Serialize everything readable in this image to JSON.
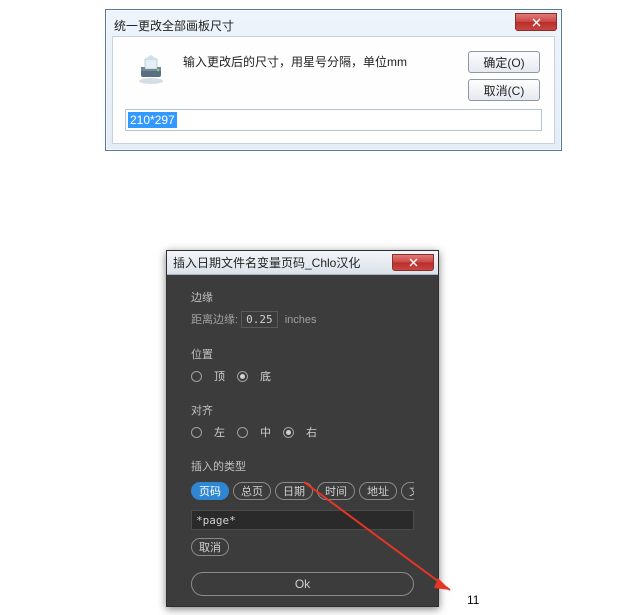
{
  "dialog1": {
    "title": "统一更改全部画板尺寸",
    "message": "输入更改后的尺寸，用星号分隔，单位mm",
    "ok_label": "确定(O)",
    "cancel_label": "取消(C)",
    "input_value": "210*297"
  },
  "dialog2": {
    "title": "插入日期文件名变量页码_Chlo汉化",
    "sect_margin": "边缘",
    "margin_sub": "距离边缘:",
    "margin_value": "0.25",
    "margin_unit": "inches",
    "sect_position": "位置",
    "pos_options": [
      "顶",
      "底"
    ],
    "pos_selected": 1,
    "sect_align": "对齐",
    "align_options": [
      "左",
      "中",
      "右"
    ],
    "align_selected": 2,
    "sect_insert": "插入的类型",
    "chips": [
      "页码",
      "总页",
      "日期",
      "时间",
      "地址",
      "文件名"
    ],
    "chip_selected": 0,
    "insert_value": "*page*",
    "cancel_label": "取消",
    "ok_label": "Ok"
  },
  "page_number": "11"
}
